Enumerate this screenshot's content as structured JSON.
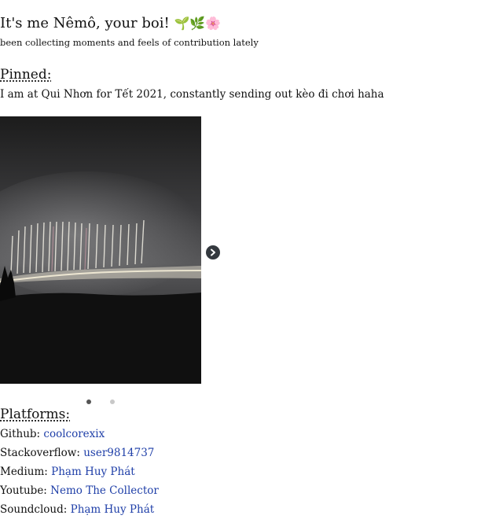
{
  "intro": {
    "title": "It's me Nêmô, your boi!",
    "emojis": [
      "🌱",
      "🌿",
      "🌸"
    ],
    "subtitle": "been collecting moments and feels of contribution lately"
  },
  "pinned": {
    "heading": "Pinned:",
    "text": "I am at Qui Nhơn for Tết 2021, constantly sending out kèo đi chơi haha"
  },
  "carousel": {
    "next_icon": "chevron-right-circle-icon",
    "active_slide": 1,
    "slide_count": 2
  },
  "platforms": {
    "heading": "Platforms:",
    "items": [
      {
        "label": "Github:",
        "link": "coolcorexix"
      },
      {
        "label": "Stackoverflow:",
        "link": "user9814737"
      },
      {
        "label": "Medium:",
        "link": "Phạm Huy Phát"
      },
      {
        "label": "Youtube:",
        "link": "Nemo The Collector"
      },
      {
        "label": "Soundcloud:",
        "link": "Phạm Huy Phát"
      }
    ]
  },
  "colors": {
    "link": "#1f3fa8",
    "dot_active": "#555555",
    "dot_inactive": "#c8c8c8"
  }
}
